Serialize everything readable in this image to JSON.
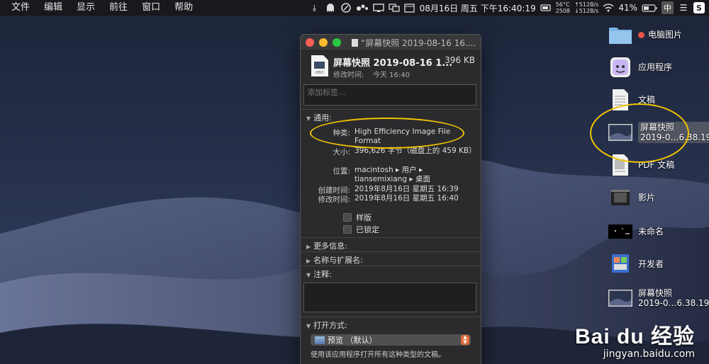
{
  "menubar": {
    "items": [
      "文件",
      "编辑",
      "显示",
      "前往",
      "窗口",
      "帮助"
    ],
    "datetime": "08月16日 周五 下午16:40:19",
    "cpu_temp": "56°C",
    "cpu_rpm": "2508",
    "net_up": "↑512B/s",
    "net_down": "↓512B/s",
    "battery": "41%",
    "ime": "中"
  },
  "desktop_items": [
    {
      "label": "电脑图片",
      "icon": "folder-icon"
    },
    {
      "label": "应用程序",
      "icon": "app-folder-icon"
    },
    {
      "label": "文稿",
      "icon": "document-icon"
    },
    {
      "label": "屏幕快照",
      "label2": "2019-0…6.38.19",
      "icon": "screenshot-thumbnail-icon"
    },
    {
      "label": "PDF 文稿",
      "icon": "pdf-document-icon"
    },
    {
      "label": "影片",
      "icon": "movie-icon"
    },
    {
      "label": "未命名",
      "icon": "image-thumbnail-icon"
    },
    {
      "label": "开发者",
      "icon": "developer-icon"
    },
    {
      "label": "屏幕快照",
      "label2": "2019-0…6.38.19",
      "icon": "screenshot-thumbnail-icon"
    }
  ],
  "info_window": {
    "title": "“屏幕快照 2019-08-16 16....",
    "file_name": "屏幕快照 2019-08-16 1...",
    "file_size": "396 KB",
    "modified_label": "修改时间:",
    "modified_value": "今天 16:40",
    "tags_placeholder": "添加标签...",
    "general_header": "通用:",
    "kind_label": "种类:",
    "kind_value": "High Efficiency Image File Format",
    "size_label": "大小:",
    "size_value": "396,626 字节（磁盘上的 459 KB）",
    "where_label": "位置:",
    "where_value": "macintosh ▸ 用户 ▸ tiansemixiang ▸ 桌面",
    "created_label": "创建时间:",
    "created_value": "2019年8月16日 星期五 16:39",
    "modified2_label": "修改时间:",
    "modified2_value": "2019年8月16日 星期五 16:40",
    "stationery_label": "样版",
    "locked_label": "已锁定",
    "more_info_header": "更多信息:",
    "name_ext_header": "名称与扩展名:",
    "comments_header": "注释:",
    "open_with_header": "打开方式:",
    "open_with_value": "预览 （默认）",
    "open_with_note": "使用该应用程序打开所有这种类型的文稿。"
  },
  "watermark": {
    "logo": "Bai du 经验",
    "url": "jingyan.baidu.com"
  },
  "colors": {
    "highlight": "#f0c400",
    "red_dot": "#e8524a"
  }
}
